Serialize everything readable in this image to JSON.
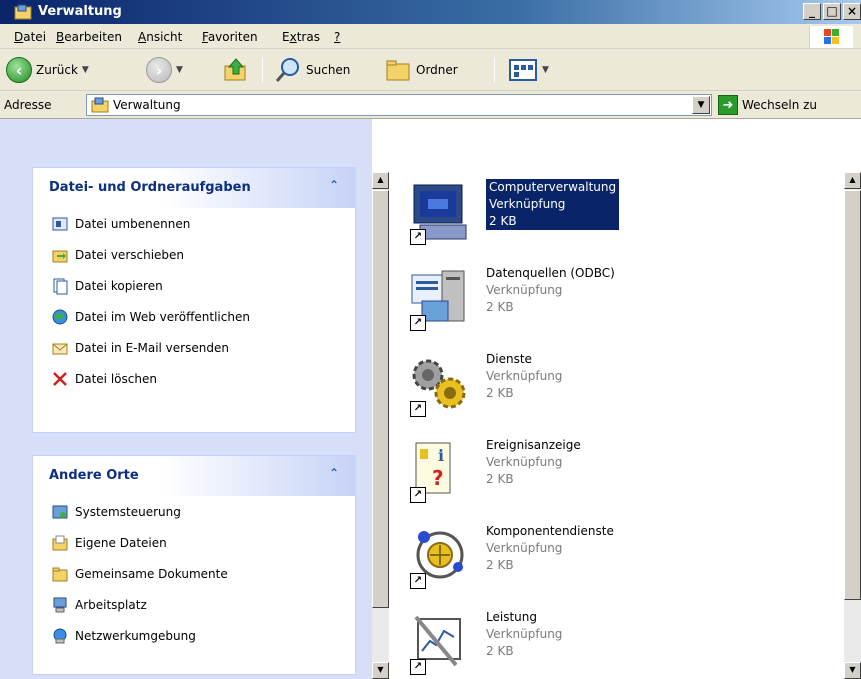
{
  "window": {
    "title": "Verwaltung"
  },
  "menu": [
    {
      "pre": "",
      "ul": "D",
      "post": "atei"
    },
    {
      "pre": "",
      "ul": "B",
      "post": "earbeiten"
    },
    {
      "pre": "",
      "ul": "A",
      "post": "nsicht"
    },
    {
      "pre": "",
      "ul": "F",
      "post": "avoriten"
    },
    {
      "pre": "E",
      "ul": "x",
      "post": "tras"
    },
    {
      "pre": "",
      "ul": "?",
      "post": ""
    }
  ],
  "toolbar": {
    "back_label": "Zurück",
    "search_label": "Suchen",
    "folders_label": "Ordner"
  },
  "address": {
    "label": "Adresse",
    "value": "Verwaltung",
    "go_label": "Wechseln zu"
  },
  "tasks_panel": {
    "title": "Datei- und Ordneraufgaben",
    "items": [
      "Datei umbenennen",
      "Datei verschieben",
      "Datei kopieren",
      "Datei im Web veröffentlichen",
      "Datei in E-Mail versenden",
      "Datei löschen"
    ]
  },
  "places_panel": {
    "title": "Andere Orte",
    "items": [
      "Systemsteuerung",
      "Eigene Dateien",
      "Gemeinsame Dokumente",
      "Arbeitsplatz",
      "Netzwerkumgebung"
    ]
  },
  "files": [
    {
      "name": "Computerverwaltung",
      "type": "Verknüpfung",
      "size": "2 KB",
      "icon": "computer-management-icon",
      "selected": true
    },
    {
      "name": "Datenquellen (ODBC)",
      "type": "Verknüpfung",
      "size": "2 KB",
      "icon": "odbc-icon",
      "selected": false
    },
    {
      "name": "Dienste",
      "type": "Verknüpfung",
      "size": "2 KB",
      "icon": "services-gears-icon",
      "selected": false
    },
    {
      "name": "Ereignisanzeige",
      "type": "Verknüpfung",
      "size": "2 KB",
      "icon": "event-viewer-icon",
      "selected": false
    },
    {
      "name": "Komponentendienste",
      "type": "Verknüpfung",
      "size": "2 KB",
      "icon": "component-services-icon",
      "selected": false
    },
    {
      "name": "Leistung",
      "type": "Verknüpfung",
      "size": "2 KB",
      "icon": "performance-icon",
      "selected": false
    }
  ],
  "colors": {
    "selection": "#0a246a",
    "taskpane_bg": "#d6dff7",
    "title_accent": "#215dc6"
  }
}
